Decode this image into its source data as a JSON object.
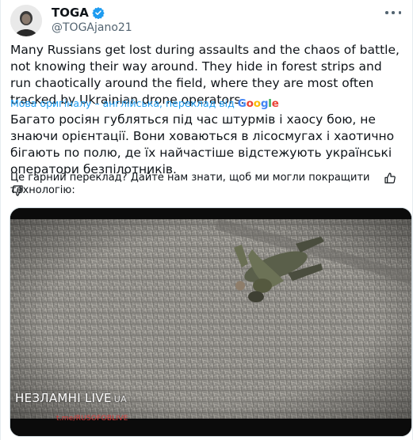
{
  "author": {
    "display_name": "TOGA",
    "handle": "@TOGAjano21",
    "verified": true,
    "verified_color": "#1d9bf0"
  },
  "tweet": {
    "original_text": "Many Russians get lost during assaults and the chaos of battle, not knowing their way around. They hide in forest strips and run chaotically around the field, where they are most often tracked by Ukrainian drone operators.",
    "translation_note": "Мова оригіналу – англійська, переклад від",
    "translation_provider": "Google",
    "translated_text": "Багато росіян губляться під час штурмів і хаосу бою, не знаючи орієнтації. Вони ховаються в лісосмугах і хаотично бігають по полю, де їх найчастіше відстежують українські оператори безпілотників.",
    "feedback_prompt": "Це гарний переклад? Дайте нам знати, щоб ми могли покращити технологію:"
  },
  "media": {
    "type": "video-still",
    "watermark": "НЕЗЛАМНІ LIVE",
    "watermark_suffix": "UA",
    "watermark_url": "t.me/RUSOFOBLIVE"
  },
  "icons": {
    "more": "more-horizontal-icon",
    "verified": "verified-badge-icon",
    "thumbs_up": "thumbs-up-icon",
    "thumbs_down": "thumbs-down-icon"
  },
  "colors": {
    "link": "#1d9bf0",
    "text": "#0f1419",
    "muted": "#536471"
  }
}
